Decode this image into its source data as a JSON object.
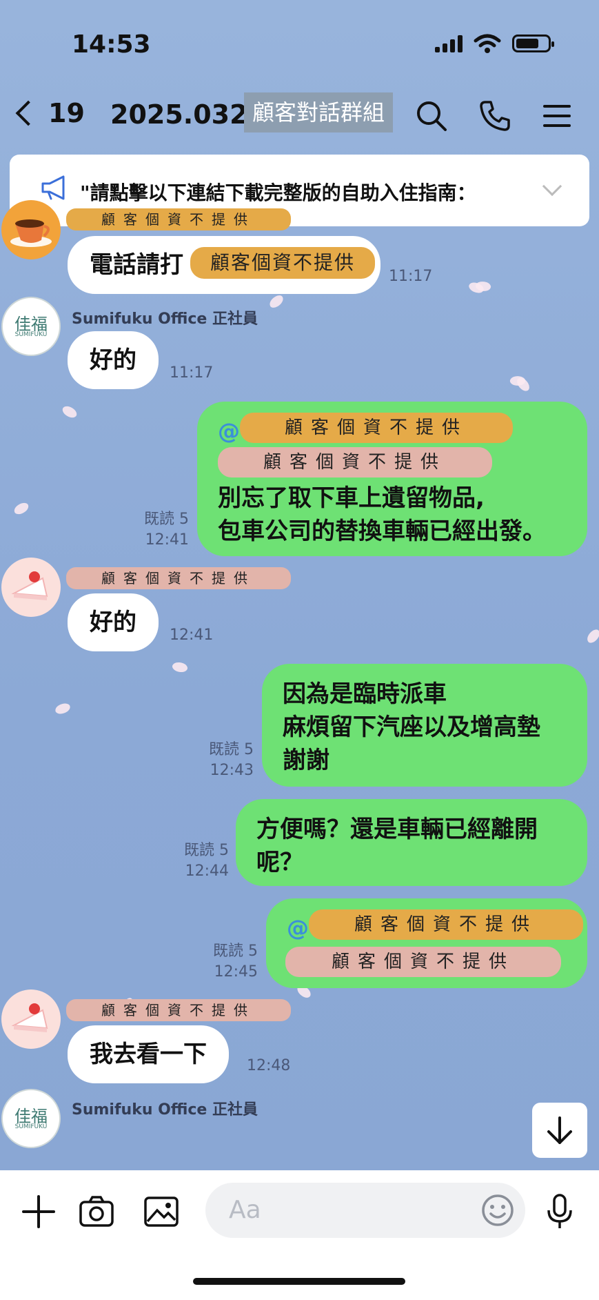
{
  "status_bar": {
    "time": "14:53"
  },
  "header": {
    "back_count": "19",
    "title": "2025.032.",
    "title_redacted": "顧客對話群組"
  },
  "announcement": {
    "text": "\"請點擊以下連結下載完整版的自助入住指南："
  },
  "messages": [
    {
      "tag": "顧客個資不提供",
      "text_prefix": "電話請打",
      "text_redacted": "顧客個資不提供",
      "time": "11:17"
    },
    {
      "sender": "Sumifuku Office 正社員",
      "text": "好的",
      "time": "11:17"
    },
    {
      "at": "@",
      "tag1": "顧客個資不提供",
      "tag2": "顧客個資不提供",
      "line1": "別忘了取下車上遺留物品,",
      "line2": "包車公司的替換車輛已經出發。",
      "read": "既読 5",
      "time": "12:41"
    },
    {
      "tag": "顧客個資不提供",
      "text": "好的",
      "time": "12:41"
    },
    {
      "line1": "因為是臨時派車",
      "line2": "麻煩留下汽座以及增高墊",
      "line3": "謝謝",
      "read": "既読 5",
      "time": "12:43"
    },
    {
      "line1": "方便嗎？還是車輛已經離開",
      "line2": "呢？",
      "read": "既読 5",
      "time": "12:44"
    },
    {
      "at": "@",
      "tag1": "顧客個資不提供",
      "tag2": "顧客個資不提供",
      "read": "既読 5",
      "time": "12:45"
    },
    {
      "tag": "顧客個資不提供",
      "text": "我去看一下",
      "time": "12:48"
    },
    {
      "sender": "Sumifuku Office 正社員"
    }
  ],
  "avatar_logo": {
    "main": "佳福",
    "sub": "SUMIFUKU"
  },
  "input": {
    "placeholder": "Aa"
  },
  "colors": {
    "bubble_out": "#6ee174",
    "tag_orange": "#e5aa48",
    "tag_pink": "#e2b4aa",
    "background": "#8fadd8"
  }
}
